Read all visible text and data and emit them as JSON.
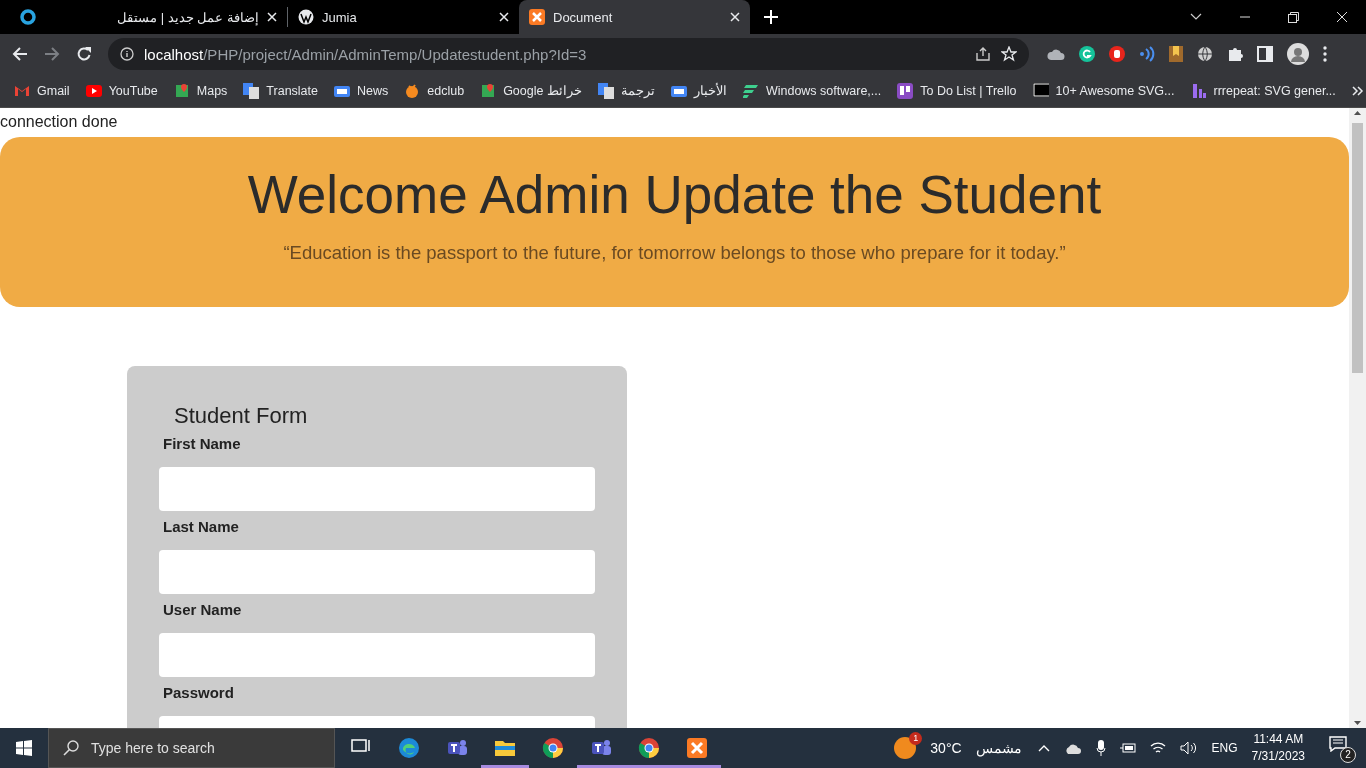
{
  "tabs": [
    {
      "title": "إضافة عمل جديد | مستقل",
      "selected": false
    },
    {
      "title": "Jumia",
      "selected": false
    },
    {
      "title": "Document",
      "selected": true
    }
  ],
  "address_bar": {
    "host": "localhost",
    "path": "/PHP/project/Admin/AdminTemp/Updatestudent.php?Id=3"
  },
  "bookmarks": [
    "Gmail",
    "YouTube",
    "Maps",
    "Translate",
    "News",
    "edclub",
    "Google خرائط",
    "ترجمة",
    "الأخبار",
    "Windows software,...",
    "To Do List | Trello",
    "10+ Awesome SVG...",
    "rrrepeat: SVG gener..."
  ],
  "page": {
    "status_text": "connection done",
    "banner": {
      "title": "Welcome Admin Update the Student",
      "quote": "“Education is the passport to the future, for tomorrow belongs to those who prepare for it today.”"
    },
    "form": {
      "title": "Student Form",
      "fields": [
        {
          "label": "First Name"
        },
        {
          "label": "Last Name"
        },
        {
          "label": "User Name"
        },
        {
          "label": "Password"
        }
      ]
    }
  },
  "taskbar": {
    "search_placeholder": "Type here to search",
    "apps": [
      {
        "kind": "taskview",
        "running": false
      },
      {
        "kind": "edge",
        "running": false
      },
      {
        "kind": "teams",
        "running": false
      },
      {
        "kind": "explorer",
        "running": true
      },
      {
        "kind": "chrome",
        "running": false
      },
      {
        "kind": "teams",
        "running": true
      },
      {
        "kind": "chrome",
        "running": true
      },
      {
        "kind": "xampp",
        "running": true
      }
    ],
    "weather": {
      "badge": "1",
      "temperature": "30°C",
      "condition": "مشمس"
    },
    "language": "ENG",
    "time": "11:44 AM",
    "date": "7/31/2023",
    "notifications": "2"
  }
}
